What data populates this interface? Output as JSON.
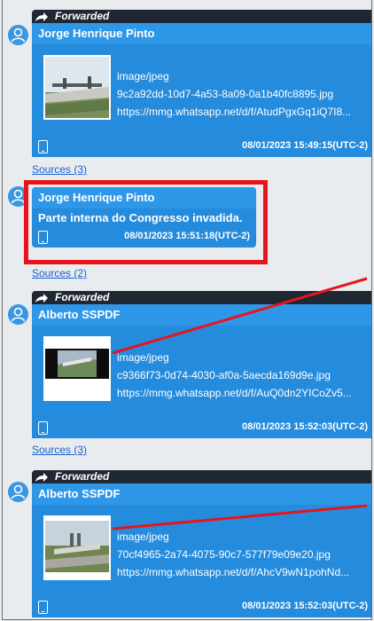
{
  "messages": [
    {
      "forwarded_label": "Forwarded",
      "sender": "Jorge Henrique Pinto",
      "attachment": {
        "mime": "image/jpeg",
        "filename": "9c2a92dd-10d7-4a53-8a09-0a1b40fc8895.jpg",
        "url": "https://mmg.whatsapp.net/d/f/AtudPgxGq1iQ7I8..."
      },
      "timestamp": "08/01/2023 15:49:15(UTC-2)",
      "sources": "Sources (3)"
    },
    {
      "sender": "Jorge Henrique Pinto",
      "text": "Parte interna do Congresso invadida.",
      "timestamp": "08/01/2023 15:51:18(UTC-2)",
      "sources": "Sources (2)"
    },
    {
      "forwarded_label": "Forwarded",
      "sender": "Alberto SSPDF",
      "attachment": {
        "mime": "image/jpeg",
        "filename": "c9366f73-0d74-4030-af0a-5aecda169d9e.jpg",
        "url": "https://mmg.whatsapp.net/d/f/AuQ0dn2YICoZv5..."
      },
      "timestamp": "08/01/2023 15:52:03(UTC-2)",
      "sources": "Sources (3)"
    },
    {
      "forwarded_label": "Forwarded",
      "sender": "Alberto SSPDF",
      "attachment": {
        "mime": "image/jpeg",
        "filename": "70cf4965-2a74-4075-90c7-577f79e09e20.jpg",
        "url": "https://mmg.whatsapp.net/d/f/AhcV9wN1pohNd..."
      },
      "timestamp": "08/01/2023 15:52:03(UTC-2)"
    }
  ],
  "icons": {
    "avatar": "user-avatar-icon",
    "forward": "forward-arrow-icon",
    "device": "phone-icon"
  },
  "colors": {
    "bubble": "#258bdc",
    "sender_bar": "#2e97e8",
    "forward_bar": "#1f2733",
    "highlight": "#e8141b",
    "link": "#1a5fd0"
  }
}
